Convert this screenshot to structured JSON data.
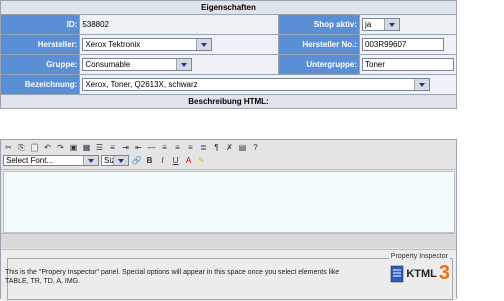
{
  "header": {
    "title": "Eigenschaften"
  },
  "row1": {
    "id_label": "ID:",
    "id_value": "538802",
    "shop_label": "Shop aktiv:",
    "shop_value": "ja"
  },
  "row2": {
    "hersteller_label": "Hersteller:",
    "hersteller_value": "Xerox Tektronix",
    "hersteller_no_label": "Hersteller No.:",
    "hersteller_no_value": "003R99607"
  },
  "row3": {
    "gruppe_label": "Gruppe:",
    "gruppe_value": "Consumable",
    "untergruppe_label": "Untergruppe:",
    "untergruppe_value": "Toner"
  },
  "row4": {
    "bezeichnung_label": "Bezeichnung:",
    "bezeichnung_value": "Xerox, Toner, Q2613X, schwarz"
  },
  "editor": {
    "title": "Beschreibung HTML:",
    "font_select": "Select Font...",
    "size_select": "Siz",
    "inspector_title": "Property Inspector",
    "inspector_text": "This is the \"Propery Inspector\" panel. Special options will appear in this space once you select elements like TABLE, TR, TD, A, IMG.",
    "logo_text": "KTML",
    "logo_number": "3"
  },
  "icons": [
    "cut-icon",
    "copy-icon",
    "paste-icon",
    "undo-icon",
    "redo-icon",
    "image-icon",
    "table-icon",
    "unordered-list-icon",
    "ordered-list-icon",
    "indent-icon",
    "outdent-icon",
    "horizontal-rule-icon",
    "align-left-icon",
    "align-center-icon",
    "align-right-icon",
    "justify-icon",
    "paragraph-icon",
    "clean-icon",
    "html-view-icon",
    "help-icon"
  ],
  "colors": {
    "label_bg": "#5a8fd6",
    "header_bg": "#dfe3ea",
    "editor_bg": "#f3fbfd"
  }
}
